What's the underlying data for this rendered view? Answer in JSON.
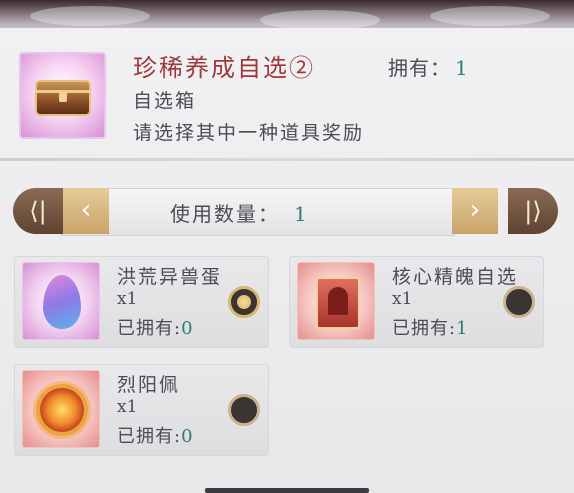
{
  "item": {
    "name": "珍稀养成自选②",
    "type": "自选箱",
    "description": "请选择其中一种道具奖励",
    "owned_label": "拥有：",
    "owned_value": "1",
    "icon": "treasure-chest-icon"
  },
  "quantity": {
    "label": "使用数量：",
    "value": "1",
    "first_icon": "⟨|",
    "prev_icon": "‹",
    "next_icon": "›",
    "last_icon": "|⟩"
  },
  "rewards": [
    {
      "name": "洪荒异兽蛋",
      "count": "x1",
      "owned_label": "已拥有:",
      "owned_value": "0",
      "selected": true,
      "icon": "beast-egg-icon"
    },
    {
      "name": "核心精魄自选",
      "count": "x1",
      "owned_label": "已拥有:",
      "owned_value": "1",
      "selected": false,
      "icon": "soul-card-icon"
    },
    {
      "name": "烈阳佩",
      "count": "x1",
      "owned_label": "已拥有:",
      "owned_value": "0",
      "selected": false,
      "icon": "sun-pendant-icon"
    }
  ],
  "colors": {
    "title": "#9c3a3a",
    "accent_value": "#2e7d72",
    "text": "#4c4c52"
  }
}
